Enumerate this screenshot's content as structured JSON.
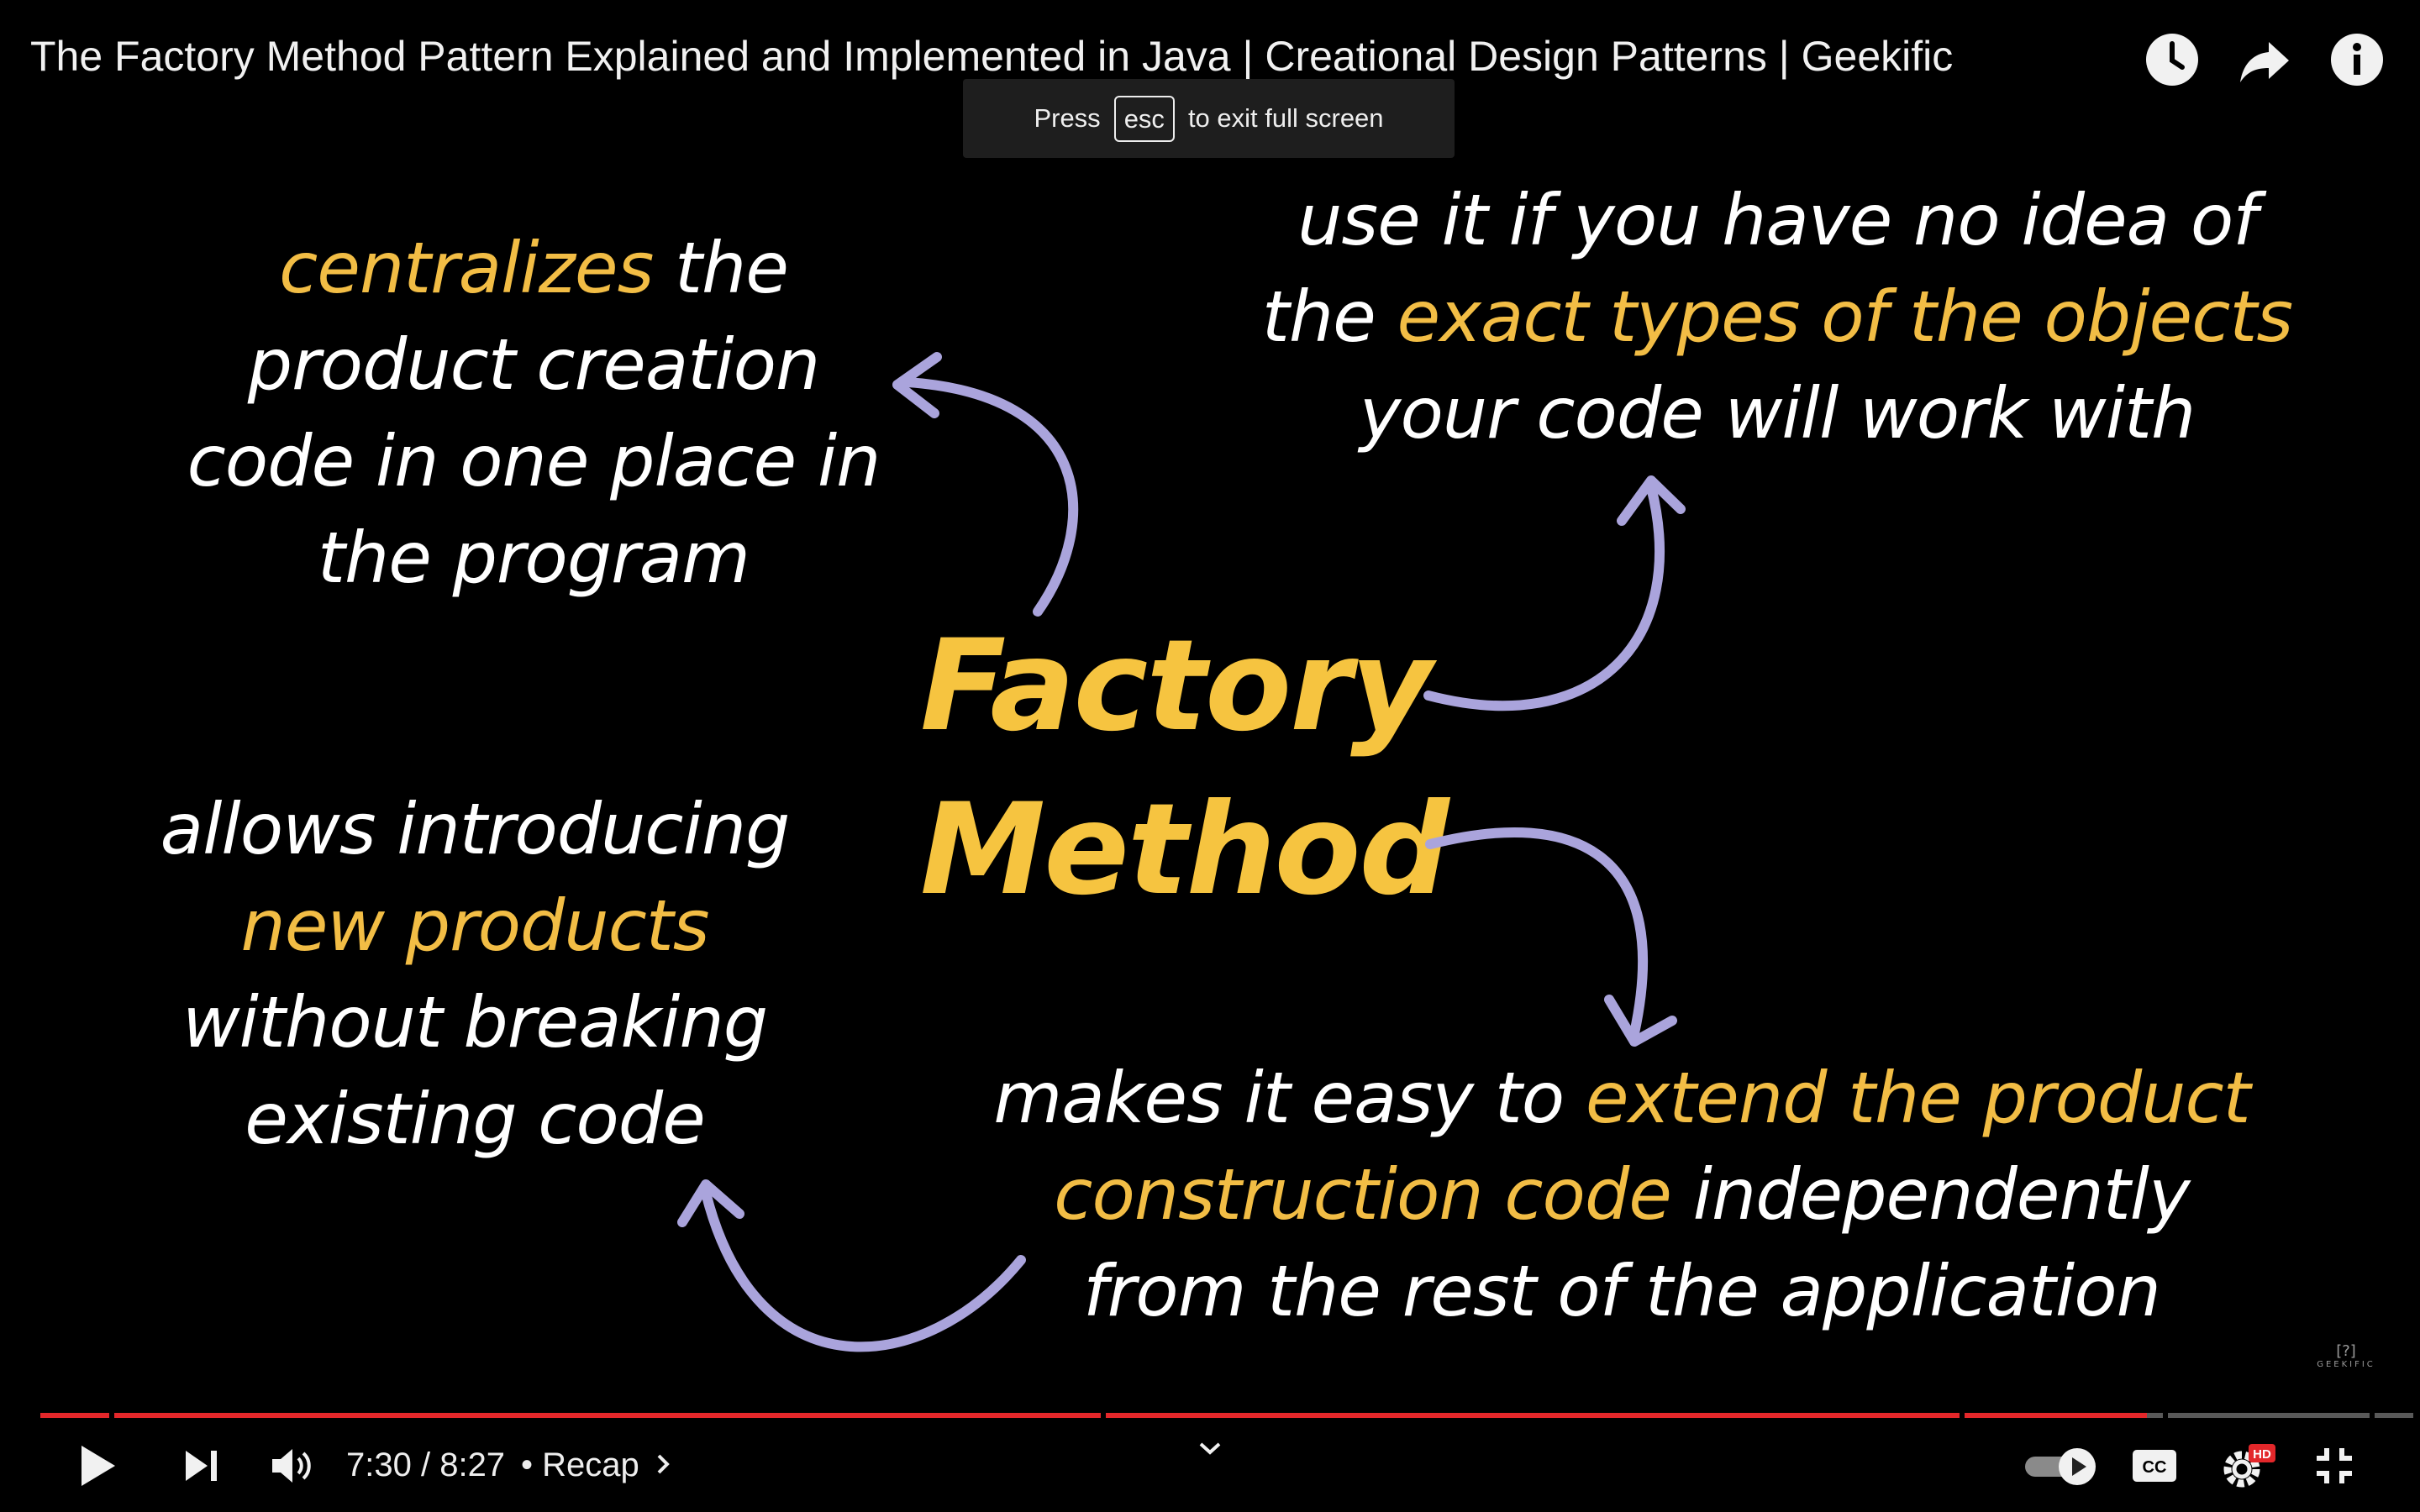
{
  "header": {
    "video_title": "The Factory Method Pattern Explained and Implemented in Java | Creational Design Patterns | Geekific",
    "icons": [
      "watch-later-icon",
      "share-icon",
      "info-icon"
    ]
  },
  "fullscreen_hint": {
    "prefix": "Press",
    "key": "esc",
    "suffix": "to exit full screen"
  },
  "slide": {
    "center_title_line1": "Factory",
    "center_title_line2": "Method",
    "top_left": {
      "l1_hl": "centralizes",
      "l1_rest": " the",
      "l2": "product creation",
      "l3": "code in one place in",
      "l4": "the program"
    },
    "top_right": {
      "l1": "use it if you have no idea of",
      "l2_pre": "the ",
      "l2_hl": "exact types of the objects",
      "l3": "your code will work with"
    },
    "bottom_left": {
      "l1": "allows introducing",
      "l2_hl": "new products",
      "l3": "without breaking",
      "l4": "existing code"
    },
    "bottom_right": {
      "l1_pre": "makes it easy to ",
      "l1_hl": "extend the product",
      "l2_hl": "construction code",
      "l2_rest": " independently",
      "l3": "from the rest of the application"
    },
    "watermark": "GEEKIFIC",
    "highlight_color": "#f2bd45",
    "title_color": "#f6c440",
    "arrow_color": "#aaa4dc"
  },
  "player": {
    "time_current": "7:30",
    "time_separator": " / ",
    "time_total": "8:27",
    "chapter_separator": " • ",
    "chapter": "Recap",
    "progress_fraction": 0.8876,
    "progress_color": "#e3272a",
    "hd_badge": "HD",
    "cc_label": "CC",
    "icons": [
      "play-icon",
      "next-icon",
      "volume-icon",
      "chevron-down-icon",
      "autoplay-toggle",
      "captions-icon",
      "settings-icon",
      "exit-fullscreen-icon"
    ]
  }
}
